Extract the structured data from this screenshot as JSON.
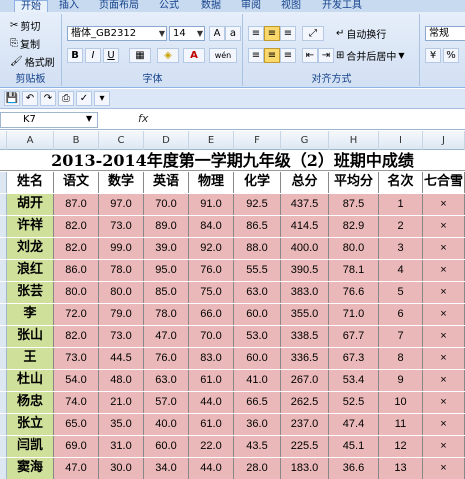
{
  "tabs": [
    "开始",
    "插入",
    "页面布局",
    "公式",
    "数据",
    "审阅",
    "视图",
    "开发工具"
  ],
  "clipboard": {
    "cut": "剪切",
    "copy": "复制",
    "format_painter": "格式刷",
    "group": "剪贴板"
  },
  "font": {
    "name": "楷体_GB2312",
    "size": "14",
    "bold": "B",
    "italic": "I",
    "underline": "U",
    "wen": "wén",
    "group": "字体"
  },
  "alignment": {
    "wrap": "自动换行",
    "merge": "合并后居中",
    "group": "对齐方式"
  },
  "number": {
    "format": "常规"
  },
  "formula_bar": {
    "cell_ref": "K7",
    "fx": "fx",
    "value": ""
  },
  "columns": [
    "A",
    "B",
    "C",
    "D",
    "E",
    "F",
    "G",
    "H",
    "I",
    "J"
  ],
  "sheet": {
    "title": "2013-2014年度第一学期九年级（2）班期中成绩",
    "headers": [
      "姓名",
      "语文",
      "数学",
      "英语",
      "物理",
      "化学",
      "总分",
      "平均分",
      "名次",
      "七合雪"
    ],
    "rows": [
      [
        "胡开",
        "87.0",
        "97.0",
        "70.0",
        "91.0",
        "92.5",
        "437.5",
        "87.5",
        "1",
        "×"
      ],
      [
        "许祥",
        "82.0",
        "73.0",
        "89.0",
        "84.0",
        "86.5",
        "414.5",
        "82.9",
        "2",
        "×"
      ],
      [
        "刘龙",
        "82.0",
        "99.0",
        "39.0",
        "92.0",
        "88.0",
        "400.0",
        "80.0",
        "3",
        "×"
      ],
      [
        "浪红",
        "86.0",
        "78.0",
        "95.0",
        "76.0",
        "55.5",
        "390.5",
        "78.1",
        "4",
        "×"
      ],
      [
        "张芸",
        "80.0",
        "80.0",
        "85.0",
        "75.0",
        "63.0",
        "383.0",
        "76.6",
        "5",
        "×"
      ],
      [
        "李",
        "72.0",
        "79.0",
        "78.0",
        "66.0",
        "60.0",
        "355.0",
        "71.0",
        "6",
        "×"
      ],
      [
        "张山",
        "82.0",
        "73.0",
        "47.0",
        "70.0",
        "53.0",
        "338.5",
        "67.7",
        "7",
        "×"
      ],
      [
        "王",
        "73.0",
        "44.5",
        "76.0",
        "83.0",
        "60.0",
        "336.5",
        "67.3",
        "8",
        "×"
      ],
      [
        "杜山",
        "54.0",
        "48.0",
        "63.0",
        "61.0",
        "41.0",
        "267.0",
        "53.4",
        "9",
        "×"
      ],
      [
        "杨忠",
        "74.0",
        "21.0",
        "57.0",
        "44.0",
        "66.5",
        "262.5",
        "52.5",
        "10",
        "×"
      ],
      [
        "张立",
        "65.0",
        "35.0",
        "40.0",
        "61.0",
        "36.0",
        "237.0",
        "47.4",
        "11",
        "×"
      ],
      [
        "闫凯",
        "69.0",
        "31.0",
        "60.0",
        "22.0",
        "43.5",
        "225.5",
        "45.1",
        "12",
        "×"
      ],
      [
        "窦海",
        "47.0",
        "30.0",
        "34.0",
        "44.0",
        "28.0",
        "183.0",
        "36.6",
        "13",
        "×"
      ]
    ]
  },
  "colors": {
    "name_fill": "#cfe09a",
    "score_fill": "#eab8b8",
    "ribbon": "#d2e0f3"
  }
}
